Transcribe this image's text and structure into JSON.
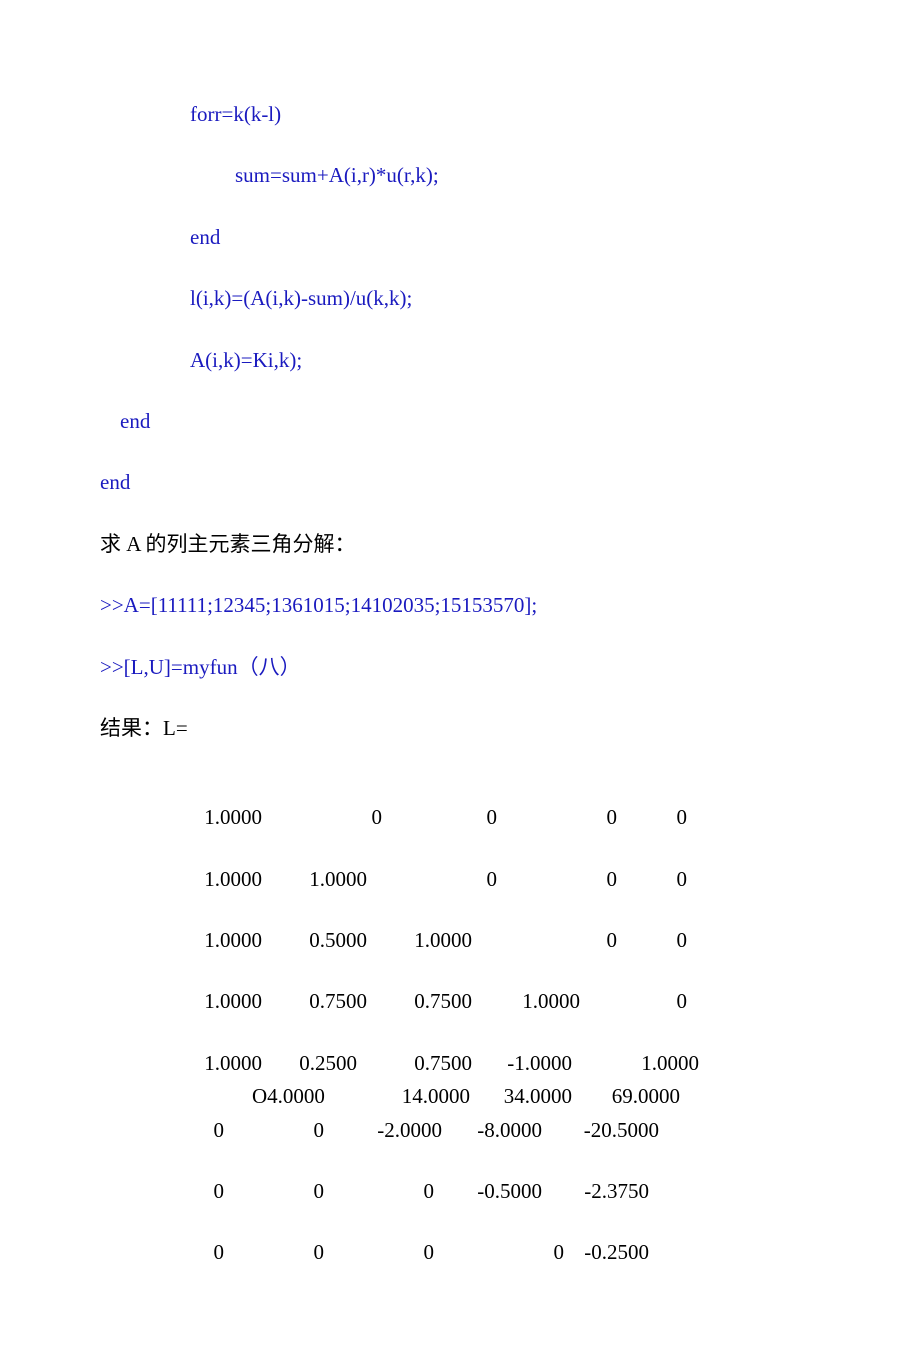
{
  "code": {
    "line1": "forr=k(k-l)",
    "line2": "sum=sum+A(i,r)*u(r,k);",
    "line3": "end",
    "line4": "l(i,k)=(A(i,k)-sum)/u(k,k);",
    "line5": "A(i,k)=Ki,k);",
    "line6": "end",
    "line7": "end"
  },
  "text": {
    "desc1": "求 A 的列主元素三角分解：",
    "cmd1": ">>A=[11111;12345;1361015;14102035;15153570];",
    "cmd2": ">>[L,U]=myfun（八）",
    "result_label": "结果：L="
  },
  "matrix_L": {
    "row1": [
      "1.0000",
      "0",
      "0",
      "0",
      "0"
    ],
    "row2": [
      "1.0000",
      "1.0000",
      "0",
      "0",
      "0"
    ],
    "row3": [
      "1.0000",
      "0.5000",
      "1.0000",
      "0",
      "0"
    ],
    "row4": [
      "1.0000",
      "0.7500",
      "0.7500",
      "1.0000",
      "0"
    ],
    "row5": [
      "1.0000",
      "0.2500",
      "0.7500",
      "-1.0000",
      "1.0000"
    ]
  },
  "matrix_U_partial": {
    "row1": [
      "O4.0000",
      "14.0000",
      "34.0000",
      "69.0000"
    ],
    "row2": [
      "0",
      "0",
      "-2.0000",
      "-8.0000",
      "-20.5000"
    ],
    "row3": [
      "0",
      "0",
      "0",
      "-0.5000",
      "-2.3750"
    ],
    "row4": [
      "0",
      "0",
      "0",
      "0",
      "-0.2500"
    ]
  }
}
